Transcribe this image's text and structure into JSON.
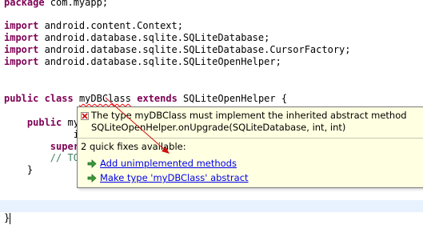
{
  "editor": {
    "lines": {
      "package": {
        "kw": "package",
        "rest": " com.myapp;"
      },
      "import1": {
        "kw": "import",
        "rest": " android.content.Context;"
      },
      "import2": {
        "kw": "import",
        "rest": " android.database.sqlite.SQLiteDatabase;"
      },
      "import3": {
        "kw": "import",
        "rest": " android.database.sqlite.SQLiteDatabase.CursorFactory;"
      },
      "import4": {
        "kw": "import",
        "rest": " android.database.sqlite.SQLiteOpenHelper;"
      },
      "class_decl": {
        "kw1": "public",
        "kw2": "class",
        "name": "myDBClass",
        "kw3": "extends",
        "rest": " SQLiteOpenHelper {"
      },
      "ctor": {
        "kw": "public",
        "rest": " my"
      },
      "ctor_cont": {
        "text": "i"
      },
      "super_call": {
        "kw": "super"
      },
      "todo": {
        "text": "// TO"
      },
      "close_inner": {
        "text": "}"
      },
      "close_outer": {
        "text": "}"
      }
    }
  },
  "quickfix": {
    "error_line1": "The type myDBClass must implement the inherited abstract method",
    "error_line2": "SQLiteOpenHelper.onUpgrade(SQLiteDatabase, int, int)",
    "count_text": "2 quick fixes available:",
    "fixes": [
      {
        "label": "Add unimplemented methods"
      },
      {
        "label": "Make type 'myDBClass' abstract"
      }
    ]
  },
  "colors": {
    "keyword": "#7f0055",
    "comment": "#3f7f5f",
    "popup_bg": "#ffffe1",
    "link": "#0000ee"
  }
}
